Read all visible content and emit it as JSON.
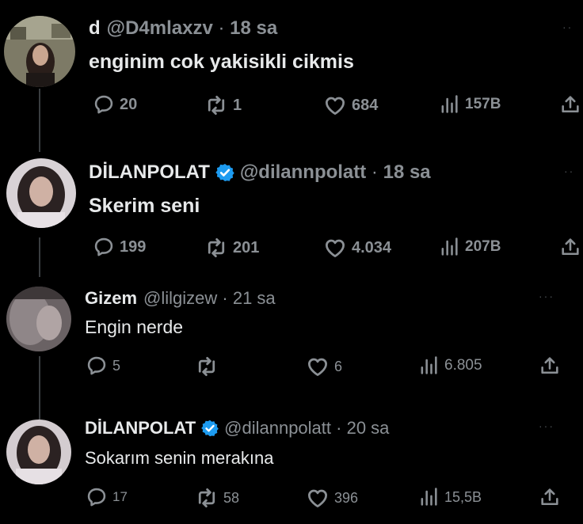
{
  "colors": {
    "background": "#000000",
    "text": "#e7e9ea",
    "muted": "#8b9095",
    "verified": "#1d9bf0"
  },
  "tweets": [
    {
      "name": "d",
      "handle": "@D4mlaxzv",
      "time": "18 sa",
      "verified": false,
      "text": "enginim cok yakisikli cikmis",
      "replies": "20",
      "retweets": "1",
      "likes": "684",
      "views": "157B",
      "icons": [
        "reply-icon",
        "retweet-icon",
        "like-icon",
        "views-icon",
        "share-icon"
      ]
    },
    {
      "name": "DİLANPOLAT",
      "handle": "@dilannpolatt",
      "time": "18 sa",
      "verified": true,
      "text": "Skerim seni",
      "replies": "199",
      "retweets": "201",
      "likes": "4.034",
      "views": "207B",
      "icons": [
        "reply-icon",
        "retweet-icon",
        "like-icon",
        "views-icon",
        "share-icon"
      ]
    },
    {
      "name": "Gizem",
      "handle": "@lilgizew",
      "time": "21 sa",
      "verified": false,
      "text": "Engin nerde",
      "replies": "5",
      "retweets": "",
      "likes": "6",
      "views": "6.805",
      "icons": [
        "reply-icon",
        "retweet-icon",
        "like-icon",
        "views-icon",
        "share-icon"
      ]
    },
    {
      "name": "DİLANPOLAT",
      "handle": "@dilannpolatt",
      "time": "20 sa",
      "verified": true,
      "text": "Sokarım senin merakına",
      "replies": "17",
      "retweets": "58",
      "likes": "396",
      "views": "15,5B",
      "icons": [
        "reply-icon",
        "retweet-icon",
        "like-icon",
        "views-icon",
        "share-icon"
      ]
    }
  ]
}
